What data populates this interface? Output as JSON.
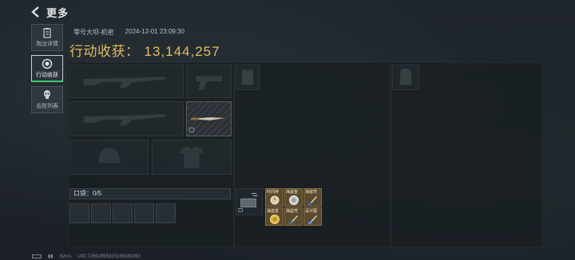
{
  "header": {
    "back_label": "更多"
  },
  "sidebar": {
    "items": [
      {
        "label": "淘汰详情",
        "icon": "clipboard-icon"
      },
      {
        "label": "行动收获",
        "icon": "target-icon",
        "active": true
      },
      {
        "label": "击败列表",
        "icon": "skull-icon"
      }
    ]
  },
  "match": {
    "map": "零号大坝-机密",
    "datetime": "2024-12-01 23:09:30",
    "haul_label": "行动收获：",
    "haul_value": "13,144,257"
  },
  "pocket": {
    "label": "口袋：",
    "count": "0/5"
  },
  "loot": [
    {
      "label": "时间钟",
      "icon": "watch-icon"
    },
    {
      "label": "海盗金",
      "icon": "coin-icon"
    },
    {
      "label": "海盗弯",
      "icon": "dagger-icon"
    },
    {
      "label": "海盗金",
      "icon": "coin-icon"
    },
    {
      "label": "海盗弯",
      "icon": "dagger-icon"
    },
    {
      "label": "设计图",
      "icon": "blueprint-icon"
    }
  ],
  "status": {
    "ping": "82ms",
    "uid": "UID:72692855825165880350"
  },
  "colors": {
    "haul": "#e1bd5e",
    "active_tab": "#3ec96e",
    "loot_gold": "#5b4a2e"
  }
}
